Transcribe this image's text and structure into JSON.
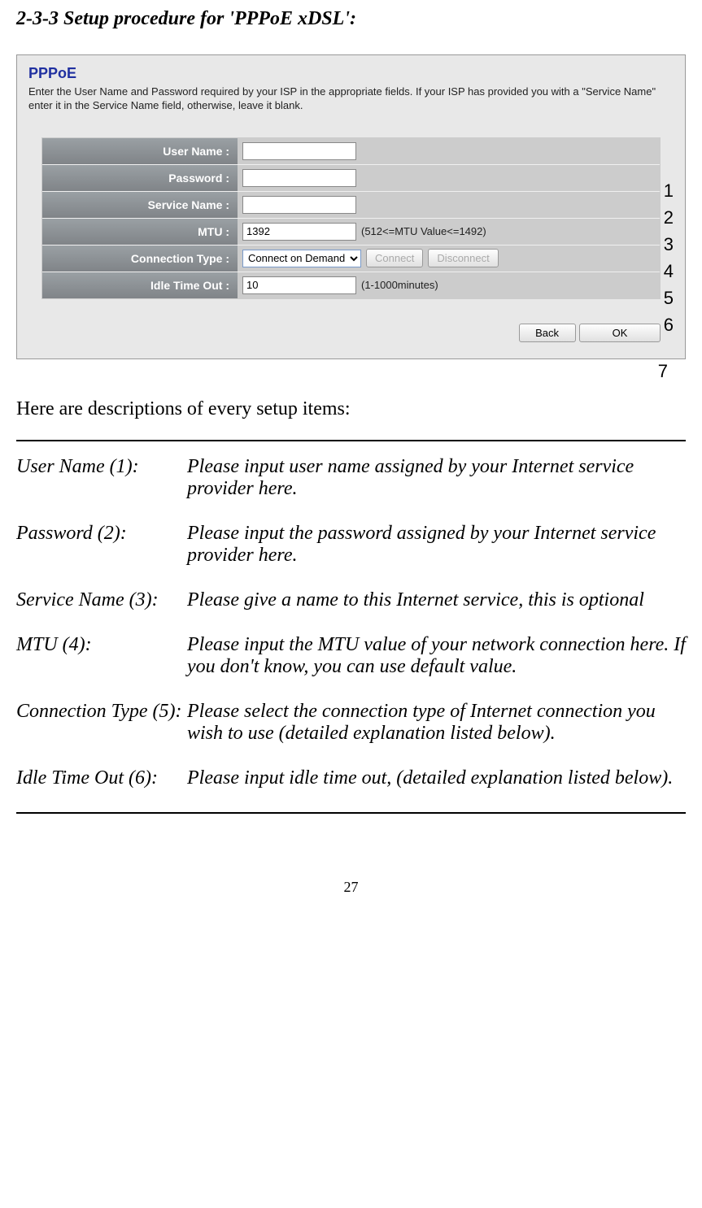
{
  "section_title": "2-3-3 Setup procedure for 'PPPoE xDSL':",
  "screenshot": {
    "title": "PPPoE",
    "desc": "Enter the User Name and Password required by your ISP in the appropriate fields. If your ISP has provided you with a \"Service Name\" enter it in the Service Name field, otherwise, leave it blank.",
    "rows": {
      "user_name": {
        "label": "User Name :",
        "value": ""
      },
      "password": {
        "label": "Password :",
        "value": ""
      },
      "service_name": {
        "label": "Service Name :",
        "value": ""
      },
      "mtu": {
        "label": "MTU :",
        "value": "1392",
        "hint": "(512<=MTU Value<=1492)"
      },
      "conn_type": {
        "label": "Connection Type :",
        "value": "Connect on Demand",
        "connect": "Connect",
        "disconnect": "Disconnect"
      },
      "idle": {
        "label": "Idle Time Out :",
        "value": "10",
        "hint": "(1-1000minutes)"
      }
    },
    "buttons": {
      "back": "Back",
      "ok": "OK"
    },
    "callouts": [
      "1",
      "2",
      "3",
      "4",
      "5",
      "6"
    ],
    "callout7": "7"
  },
  "guide": "Here are descriptions of every setup items:",
  "items": [
    {
      "term": "User Name (1):",
      "def": "Please input user name assigned by your Internet service provider here."
    },
    {
      "term": "Password (2):",
      "def": "Please input the password assigned by your Internet service provider here."
    },
    {
      "term": "Service Name (3):",
      "def": "Please give a name to this Internet service, this is optional"
    },
    {
      "term": "MTU (4):",
      "def": "Please input the MTU value of your network connection here. If you don't know, you can use default value."
    },
    {
      "term": "Connection Type (5):",
      "def": "Please select the connection type of Internet connection you wish to use (detailed explanation listed below)."
    },
    {
      "term": "Idle Time Out (6):",
      "def": "Please input idle time out, (detailed explanation listed below)."
    }
  ],
  "page_number": "27"
}
